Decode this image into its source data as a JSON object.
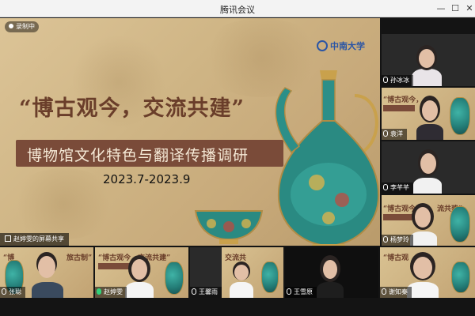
{
  "window": {
    "title": "腾讯会议",
    "buttons": {
      "minimize": "—",
      "maximize": "☐",
      "close": "✕"
    }
  },
  "slide": {
    "recording_label": "录制中",
    "university_name": "中南大学",
    "title": "“博古观今，交流共建”",
    "subtitle": "博物馆文化特色与翻译传播调研",
    "date_range": "2023.7-2023.9",
    "share_label": "赵婷雯的屏幕共享"
  },
  "participants": [
    {
      "name": "孙冰冰",
      "mic_active": false
    },
    {
      "name": "袁洋",
      "mic_active": false
    },
    {
      "name": "李芊芊",
      "mic_active": false
    },
    {
      "name": "杨梦玲",
      "mic_active": false
    },
    {
      "name": "张聪",
      "mic_active": false
    },
    {
      "name": "赵婷雯",
      "mic_active": true
    },
    {
      "name": "王馨雨",
      "mic_active": false
    },
    {
      "name": "王雪原",
      "mic_active": false
    },
    {
      "name": "谢知秦",
      "mic_active": false
    }
  ],
  "colors": {
    "active_speaker": "#2dbd6e",
    "slide_brown": "#7a4b39",
    "brand_blue": "#2a55a5"
  }
}
